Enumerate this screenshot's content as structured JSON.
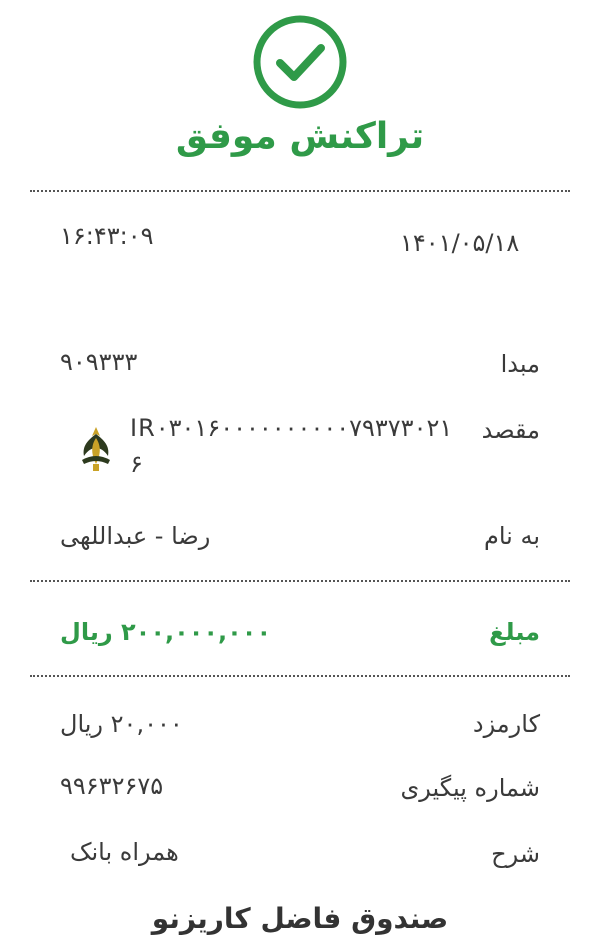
{
  "status": {
    "icon": "check-circle-icon",
    "title": "تراکنش موفق",
    "color": "#2f9a48"
  },
  "receipt": {
    "date": "۱۴۰۱/۰۵/۱۸",
    "time": "۱۶:۴۳:۰۹",
    "source_label": "مبدا",
    "source_value": "۹۰۹۳۳۳",
    "destination_label": "مقصد",
    "destination_value": "IR۰۳۰۱۶۰۰۰۰۰۰۰۰۰۰۷۹۳۷۳۰۲۱۶",
    "destination_bank_icon": "bank-emblem-icon",
    "name_label": "به نام",
    "name_value": "رضا  -  عبداللهی",
    "amount_label": "مبلغ",
    "amount_value": "۲۰۰,۰۰۰,۰۰۰ ریال",
    "fee_label": "کارمزد",
    "fee_value": "۲۰,۰۰۰ ریال",
    "tracking_label": "شماره پیگیری",
    "tracking_value": "۹۹۶۳۲۶۷۵",
    "description_label": "شرح",
    "description_value": "همراه بانک"
  },
  "footer": {
    "text": "صندوق فاضل کاریزنو"
  }
}
